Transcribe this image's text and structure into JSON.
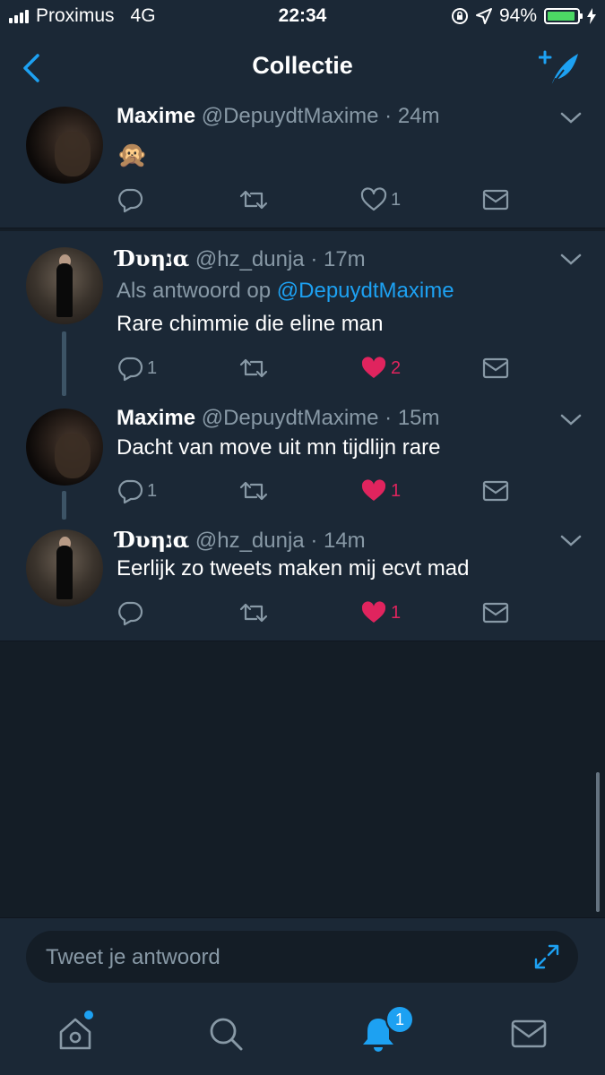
{
  "status_bar": {
    "carrier": "Proximus",
    "network": "4G",
    "time": "22:34",
    "battery": "94%",
    "battery_level": 0.94,
    "icons": [
      "signal-icon",
      "orientation-lock-icon",
      "location-icon",
      "battery-icon",
      "charging-icon"
    ]
  },
  "nav": {
    "title": "Collectie",
    "back_icon": "chevron-left-icon",
    "compose_icon": "compose-tweet-icon"
  },
  "tweets": [
    {
      "name": "Maxime",
      "handle": "@DepuydtMaxime",
      "time": "· 24m",
      "text": "🙊",
      "reply_count": "",
      "like_count": "1",
      "liked": false
    },
    {
      "name": "Ɗυηנα",
      "handle": "@hz_dunja",
      "time": "· 17m",
      "reply_prefix": "Als antwoord op ",
      "reply_to": "@DepuydtMaxime",
      "text": "Rare chimmie die eline man",
      "reply_count": "1",
      "like_count": "2",
      "liked": true
    },
    {
      "name": "Maxime",
      "handle": "@DepuydtMaxime",
      "time": "· 15m",
      "text": "Dacht van move uit mn tijdlijn rare",
      "reply_count": "1",
      "like_count": "1",
      "liked": true
    },
    {
      "name": "Ɗυηנα",
      "handle": "@hz_dunja",
      "time": "· 14m",
      "text": "Eerlijk zo tweets maken mij ecvt mad",
      "reply_count": "",
      "like_count": "1",
      "liked": true
    }
  ],
  "reply_bar": {
    "placeholder": "Tweet je antwoord"
  },
  "tab_bar": {
    "notification_count": "1",
    "tabs": [
      "home-icon",
      "search-icon",
      "notifications-icon",
      "messages-icon"
    ]
  },
  "colors": {
    "background": "#141d26",
    "card": "#1b2836",
    "accent": "#1da1f2",
    "like": "#e0245e",
    "muted": "#8899a6"
  }
}
